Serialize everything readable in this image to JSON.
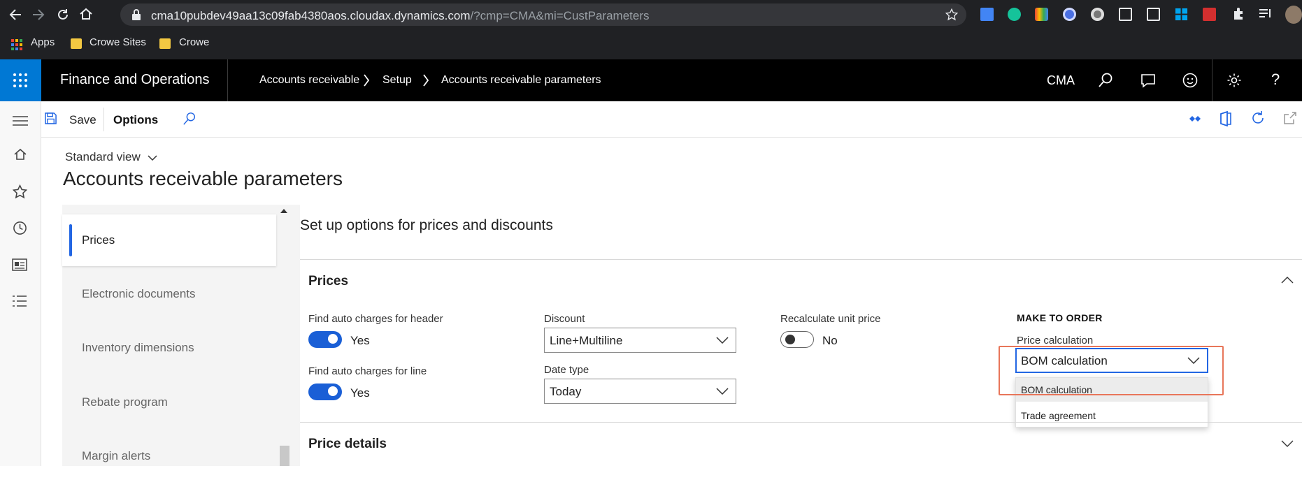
{
  "browser": {
    "url_host": "cma10pubdev49aa13c09fab4380aos.cloudax.dynamics.com",
    "url_rest": "/?cmp=CMA&mi=CustParameters",
    "bookmarks": [
      "Apps",
      "Crowe Sites",
      "Crowe"
    ]
  },
  "header": {
    "app_title": "Finance and Operations",
    "breadcrumbs": [
      "Accounts receivable",
      "Setup",
      "Accounts receivable parameters"
    ],
    "company": "CMA"
  },
  "action_pane": {
    "save_label": "Save",
    "options_label": "Options"
  },
  "page": {
    "view": "Standard view",
    "title": "Accounts receivable parameters"
  },
  "tabs": [
    "Prices",
    "Electronic documents",
    "Inventory dimensions",
    "Rebate program",
    "Margin alerts"
  ],
  "detail": {
    "heading": "Set up options for prices and discounts",
    "prices_section": {
      "title": "Prices",
      "auto_charges_header_label": "Find auto charges for header",
      "auto_charges_header_value": "Yes",
      "auto_charges_line_label": "Find auto charges for line",
      "auto_charges_line_value": "Yes",
      "discount_label": "Discount",
      "discount_value": "Line+Multiline",
      "date_type_label": "Date type",
      "date_type_value": "Today",
      "recalc_label": "Recalculate unit price",
      "recalc_value": "No",
      "make_to_order_label": "MAKE TO ORDER",
      "price_calc_label": "Price calculation",
      "price_calc_value": "BOM calculation",
      "price_calc_options": [
        "BOM calculation",
        "Trade agreement"
      ]
    },
    "price_details_title": "Price details"
  },
  "colors": {
    "accent": "#2266e3",
    "toggle_on": "#1a5fd6",
    "highlight": "#e8765a",
    "waffle": "#0078d4"
  }
}
